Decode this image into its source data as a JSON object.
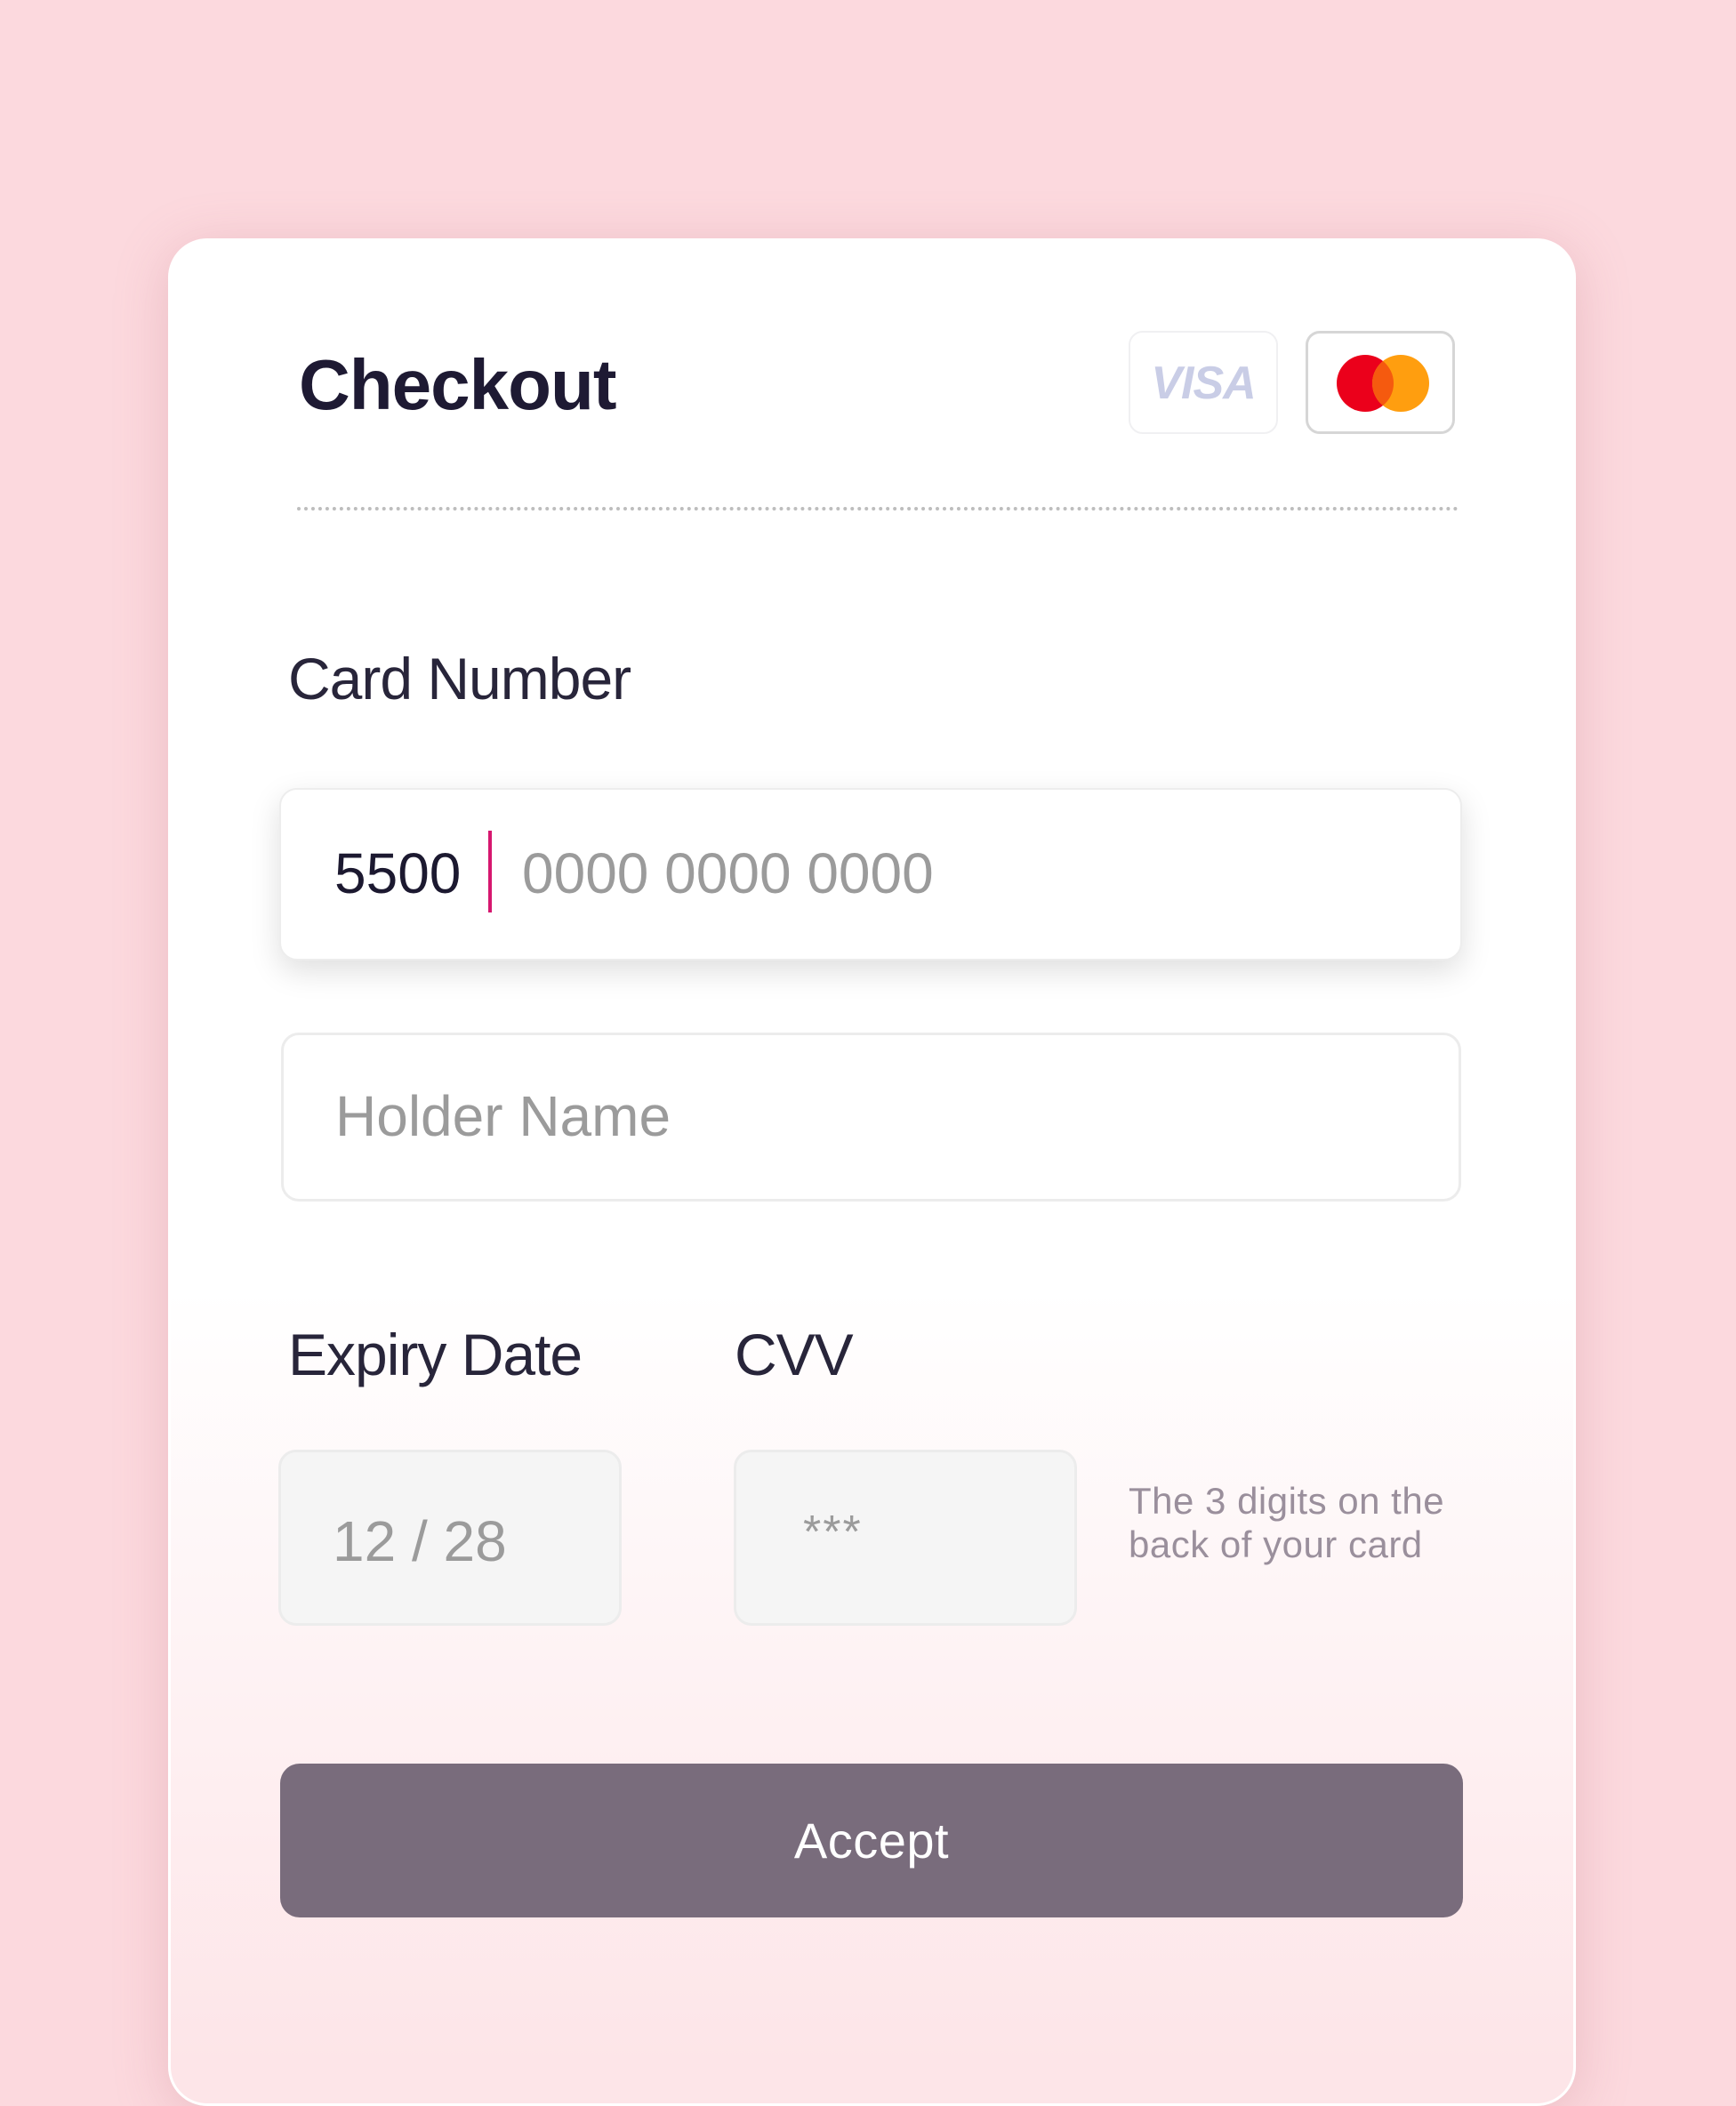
{
  "checkout": {
    "title": "Checkout",
    "brands": {
      "visa_label": "VISA",
      "visa_icon": "visa-logo-icon",
      "mastercard_icon": "mastercard-logo-icon",
      "mastercard_colors": [
        "#eb001b",
        "#ff9e0f",
        "#f55a0f"
      ]
    },
    "card_number": {
      "label": "Card Number",
      "typed_value": "5500",
      "placeholder": "0000 0000 0000"
    },
    "holder_name": {
      "placeholder": "Holder Name"
    },
    "expiry": {
      "label": "Expiry Date",
      "value": "12 / 28"
    },
    "cvv": {
      "label": "CVV",
      "value": "***",
      "help_text_line1": "The 3 digits on the",
      "help_text_line2": "back of your card"
    },
    "accept_label": "Accept",
    "colors": {
      "background": "#fcd9de",
      "caret": "#d6176f",
      "button": "#796c7c",
      "title": "#1e1a33"
    }
  }
}
